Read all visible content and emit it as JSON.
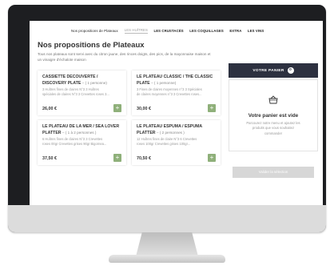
{
  "nav": {
    "items": [
      {
        "label": "Nos propositions de Plateaux"
      },
      {
        "label": "LES HUÎTRES"
      },
      {
        "label": "LES CRUSTACÉS"
      },
      {
        "label": "LES COQUILLAGES"
      },
      {
        "label": "EXTRA"
      },
      {
        "label": "LES VINS"
      }
    ]
  },
  "page": {
    "title": "Nos propositions de Plateaux",
    "intro": "Tous nos plateaux sont servi avec du citron jaune, des rinces doigts, des pics, de la mayonnaise maison et un vinaigre d'échalote maison"
  },
  "cards": [
    {
      "title": "CASSIETTE DECOUVERTE / DISCOVERY PLATE",
      "persons": "– ( 1 personne)",
      "desc1": "3 Huîtres fines de claires N°3 3 Huîtres",
      "desc2": "spéciales de claires N°3 3 Crevettes roses 3...",
      "price": "26,00 €",
      "add": "+"
    },
    {
      "title": "LE PLATEAU CLASSIC / THE CLASSIC PLATE",
      "persons": "– ( 1 personne)",
      "desc1": "3 Fines de claires moyennes n°3 3 Spéciales",
      "desc2": "de claires moyennes n°3 3 Crevettes roses...",
      "price": "30,00 €",
      "add": "+"
    },
    {
      "title": "LE PLATEAU DE LA MER / SEA LOVER PLATTER",
      "persons": "– ( 1 à 2 personnes )",
      "desc1": "6 Huîtres fines de claires N°3 3 Crevettes",
      "desc2": "roses 00gr Crevettes grises 90gr Bigornea...",
      "price": "37,50 €",
      "add": "+"
    },
    {
      "title": "LE PLATEAU ESPUMA / ESPUMA PLATTER",
      "persons": "– ( 2 personnes )",
      "desc1": "12 Huîtres fines de claire N°3 6 Crevettes",
      "desc2": "roses 100gr Crevettes grises 100gr...",
      "price": "70,50 €",
      "add": "+"
    }
  ],
  "cart": {
    "button_label": "VOTRE PANIER",
    "count": "0",
    "empty_title": "Votre panier est vide",
    "empty_text": "Parcourez notre menu et ajoutez les produits que vous souhaitez commander",
    "validate_label": "Valider la sélection"
  },
  "colors": {
    "accent_green": "#8fb07a",
    "cart_dark": "#2d3140",
    "disabled": "#d7d7d7"
  }
}
